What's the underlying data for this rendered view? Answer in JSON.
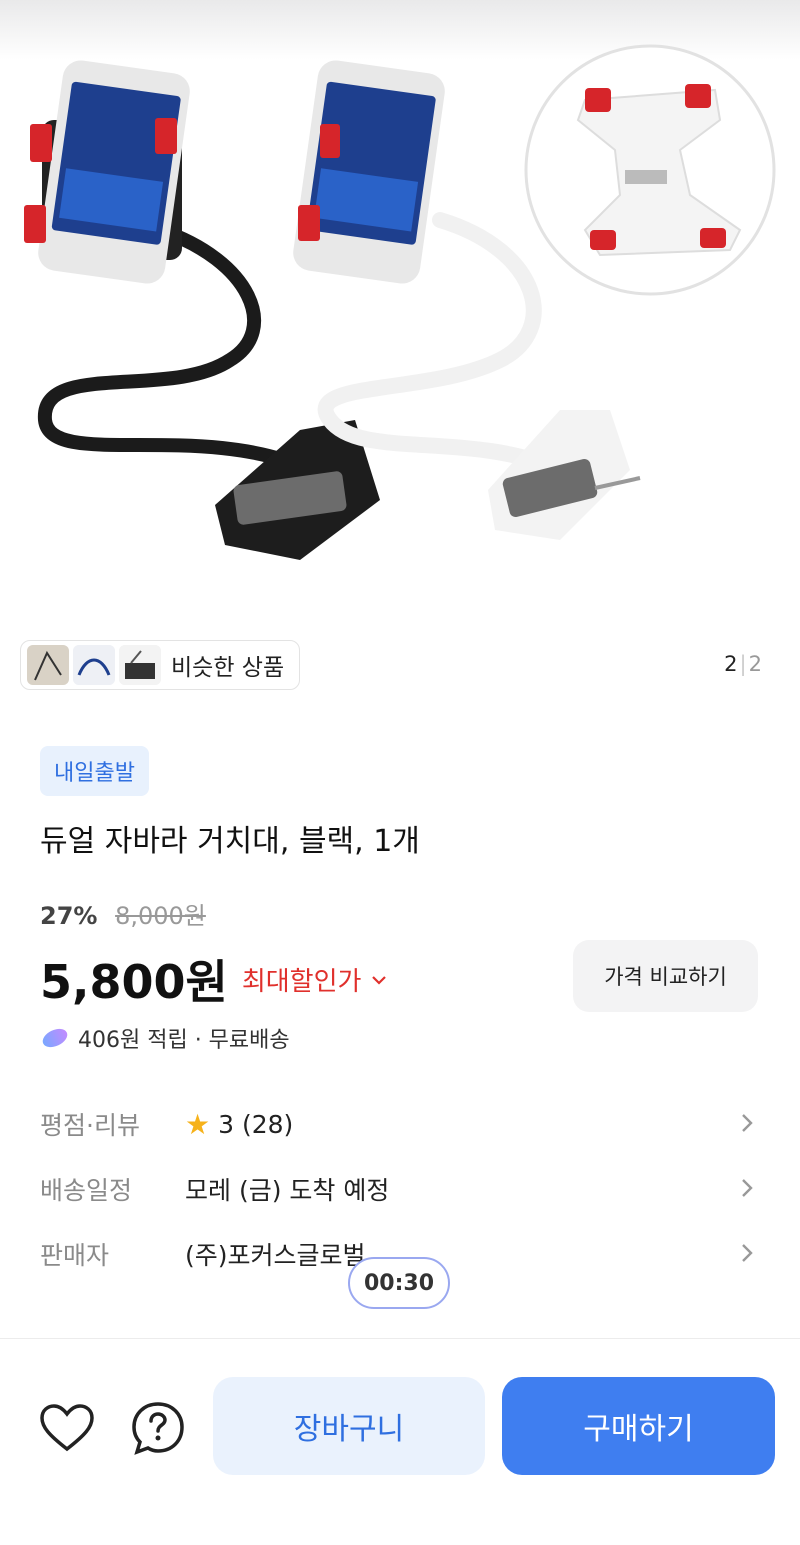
{
  "gallery": {
    "current_index": "2",
    "separator": "|",
    "total": "2"
  },
  "similar": {
    "label": "비슷한 상품"
  },
  "badge": {
    "label": "내일출발"
  },
  "product": {
    "title": "듀얼 자바라 거치대, 블랙, 1개",
    "discount_percent": "27%",
    "original_price": "8,000원",
    "price": "5,800원",
    "max_discount_label": "최대할인가",
    "compare_button": "가격 비교하기",
    "points_text": "406원 적립 · 무료배송"
  },
  "info": {
    "rating": {
      "label": "평점·리뷰",
      "score": "3",
      "count": "(28)"
    },
    "delivery": {
      "label": "배송일정",
      "value": "모레 (금) 도착 예정"
    },
    "seller": {
      "label": "판매자",
      "value": "(주)포커스글로벌"
    }
  },
  "timer": {
    "value": "00:30"
  },
  "bottom": {
    "cart_button": "장바구니",
    "buy_button": "구매하기"
  },
  "colors": {
    "accent": "#3f7ef0",
    "badge_bg": "#e8f1fd",
    "discount_red": "#e0302c",
    "star": "#f6b21b"
  },
  "icons": [
    "heart-icon",
    "question-icon",
    "star-icon",
    "chevron-right-icon",
    "chevron-down-icon",
    "points-icon"
  ]
}
